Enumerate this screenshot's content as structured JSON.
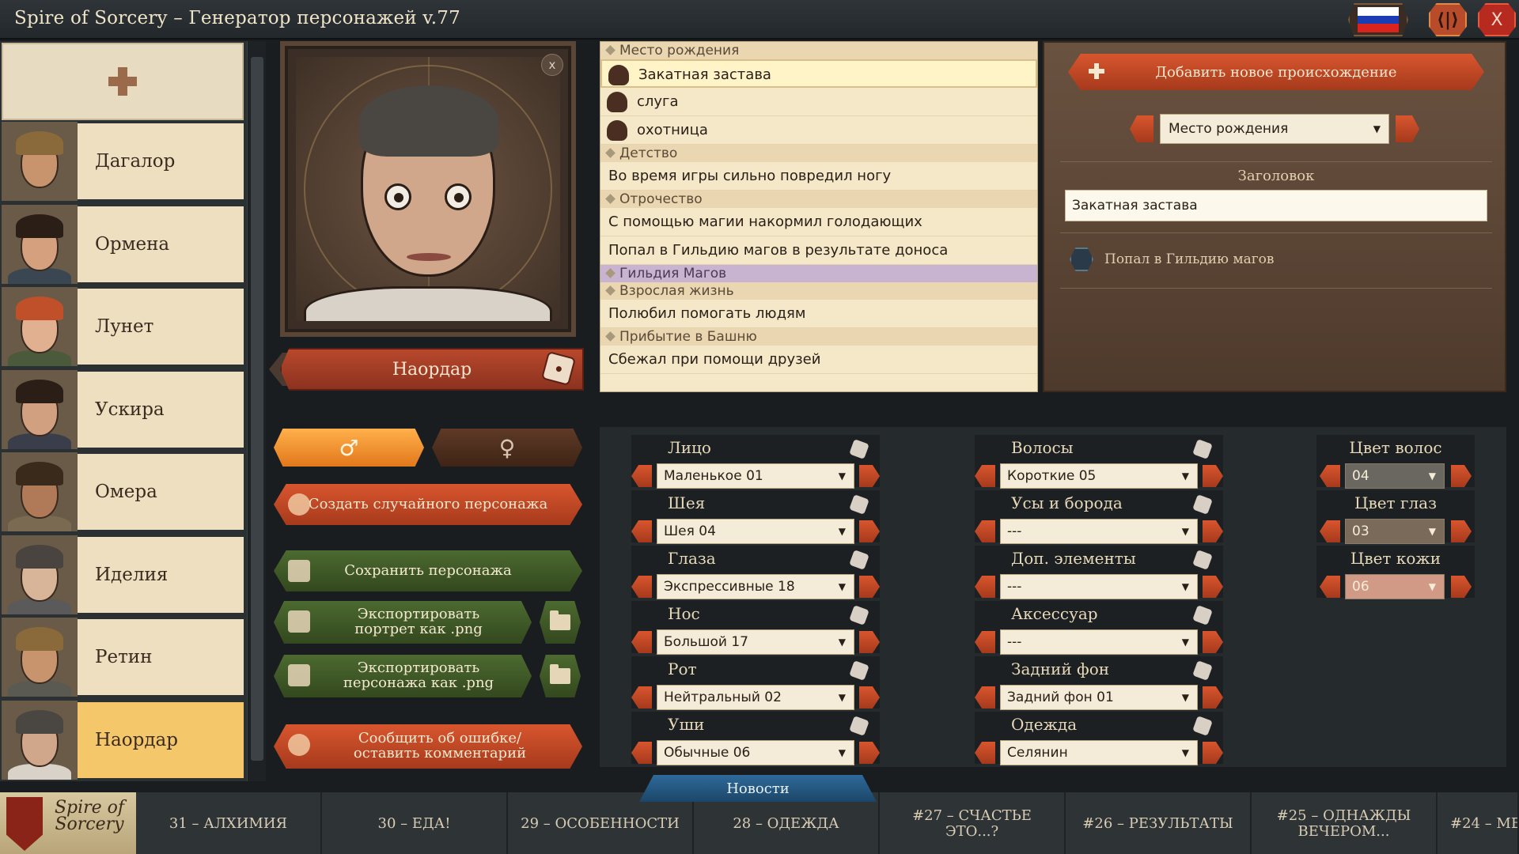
{
  "window": {
    "title": "Spire of Sorcery – Генератор персонажей  v.77",
    "settings_glyph": "⟨|⟩",
    "close_glyph": "X",
    "flag_colors": [
      "#ffffff",
      "#1c3cb4",
      "#d8241c"
    ]
  },
  "characters": [
    {
      "name": "Дагалор",
      "hair": "#8a6a3a",
      "skin": "#c8946e",
      "cloth": "#6a5a48"
    },
    {
      "name": "Ормена",
      "hair": "#2a1e16",
      "skin": "#d4a07e",
      "cloth": "#3a4652"
    },
    {
      "name": "Лунет",
      "hair": "#c0502a",
      "skin": "#e0b090",
      "cloth": "#4a5a3a"
    },
    {
      "name": "Ускира",
      "hair": "#2a1e16",
      "skin": "#d0a080",
      "cloth": "#3a3e4a"
    },
    {
      "name": "Омера",
      "hair": "#3a2a1c",
      "skin": "#b07a58",
      "cloth": "#7a6a52"
    },
    {
      "name": "Иделия",
      "hair": "#4a4440",
      "skin": "#d8b498",
      "cloth": "#5a5a5a"
    },
    {
      "name": "Ретин",
      "hair": "#8a6a3a",
      "skin": "#c8946e",
      "cloth": "#5a5a52"
    },
    {
      "name": "Наордар",
      "hair": "#4a4642",
      "skin": "#d0a78a",
      "cloth": "#d8d2c8"
    }
  ],
  "selected_character_index": 7,
  "portrait": {
    "close_label": "x"
  },
  "name_banner": {
    "name": "Наордар",
    "back_glyph": "◂"
  },
  "gender": {
    "male": "♂",
    "female": "♀"
  },
  "actions": {
    "random": "Создать случайного персонажа",
    "save": "Сохранить персонажа",
    "export_portrait": "Экспортировать портрет как .png",
    "export_character": "Экспортировать персонажа как .png",
    "report": "Сообщить об ошибке/оставить комментарий"
  },
  "story": [
    {
      "type": "header",
      "label": "Место рождения"
    },
    {
      "type": "item",
      "label": "Закатная застава",
      "icon": true,
      "selected": true
    },
    {
      "type": "item",
      "label": "слуга",
      "icon": true
    },
    {
      "type": "item",
      "label": "охотница",
      "icon": true
    },
    {
      "type": "header",
      "label": "Детство"
    },
    {
      "type": "item",
      "label": "Во время игры сильно повредил ногу"
    },
    {
      "type": "header",
      "label": "Отрочество"
    },
    {
      "type": "item",
      "label": "С помощью магии накормил голодающих"
    },
    {
      "type": "item",
      "label": "Попал в Гильдию магов в результате доноса"
    },
    {
      "type": "header",
      "label": "Гильдия Магов",
      "purple": true
    },
    {
      "type": "header",
      "label": "Взрослая жизнь"
    },
    {
      "type": "item",
      "label": "Полюбил помогать людям"
    },
    {
      "type": "header",
      "label": "Прибытие в Башню"
    },
    {
      "type": "item",
      "label": "Сбежал при помощи друзей"
    }
  ],
  "origin_panel": {
    "add_button": "Добавить новое происхождение",
    "category": "Место рождения",
    "dropdown_arrow": "▼",
    "heading_label": "Заголовок",
    "heading_value": "Закатная застава",
    "guild_label": "Попал в Гильдию магов"
  },
  "appearance_left": [
    {
      "label": "Лицо",
      "value": "Маленькое 01"
    },
    {
      "label": "Шея",
      "value": "Шея 04"
    },
    {
      "label": "Глаза",
      "value": "Экспрессивные 18"
    },
    {
      "label": "Нос",
      "value": "Большой 17"
    },
    {
      "label": "Рот",
      "value": "Нейтральный 02"
    },
    {
      "label": "Уши",
      "value": "Обычные 06"
    }
  ],
  "appearance_mid": [
    {
      "label": "Волосы",
      "value": "Короткие 05"
    },
    {
      "label": "Усы и борода",
      "value": "---"
    },
    {
      "label": "Доп. элементы",
      "value": "---"
    },
    {
      "label": "Аксессуар",
      "value": "---"
    },
    {
      "label": "Задний фон",
      "value": "Задний фон 01"
    },
    {
      "label": "Одежда",
      "value": "Селянин"
    }
  ],
  "appearance_colors": [
    {
      "label": "Цвет волос",
      "value": "04",
      "bg": "#6a6660"
    },
    {
      "label": "Цвет глаз",
      "value": "03",
      "bg": "#7a6a5a"
    },
    {
      "label": "Цвет кожи",
      "value": "06",
      "bg": "#d09a86"
    }
  ],
  "news": {
    "tab_label": "Новости",
    "logo_text": "Spire of Sorcery",
    "items": [
      "31 – АЛХИМИЯ",
      "30 – ЕДА!",
      "29 – ОСОБЕННОСТИ",
      "28 – ОДЕЖДА",
      "#27 – СЧАСТЬЕ ЭТО...?",
      "#26 – РЕЗУЛЬТАТЫ",
      "#25 – ОДНАЖДЫ ВЕЧЕРОМ...",
      "#24 – МЕ"
    ]
  }
}
